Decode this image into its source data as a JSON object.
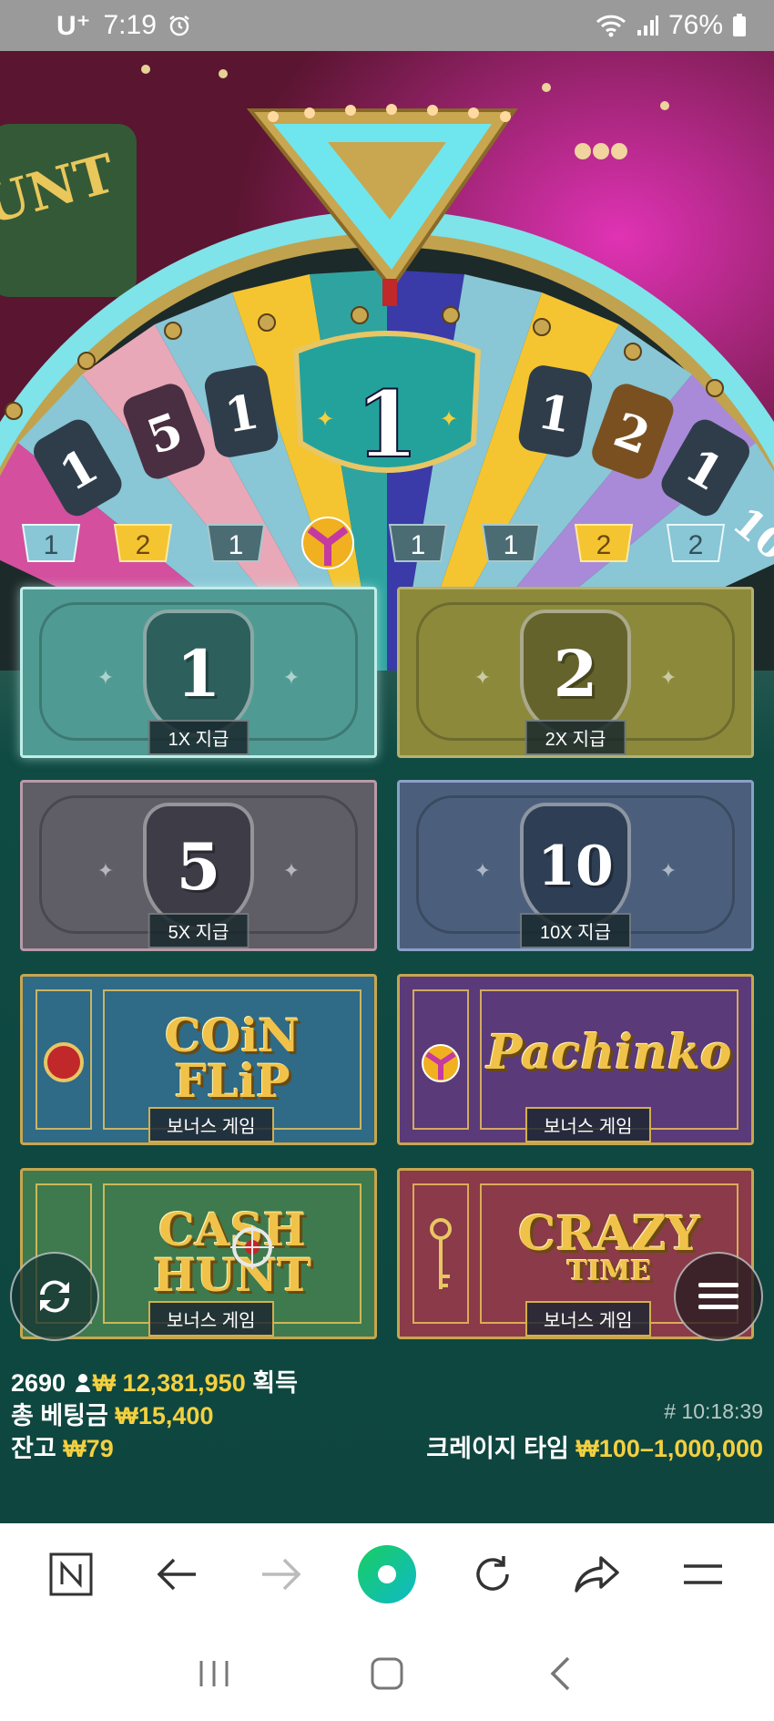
{
  "status_bar": {
    "carrier": "U⁺",
    "time": "7:19",
    "battery": "76%",
    "icons": [
      "alarm-icon",
      "wifi-icon",
      "signal-icon",
      "battery-icon"
    ]
  },
  "wheel": {
    "pointer_value": "1",
    "segment_labels": [
      "1",
      "5",
      "1",
      "1",
      "2",
      "1",
      "10"
    ],
    "tab_labels": [
      "1",
      "2",
      "1",
      "1",
      "1",
      "2",
      "2"
    ]
  },
  "bet_tiles": [
    {
      "number": "1",
      "label": "1X 지급",
      "color": "#4f9b93"
    },
    {
      "number": "2",
      "label": "2X 지급",
      "color": "#8c8a3a"
    },
    {
      "number": "5",
      "label": "5X 지급",
      "color": "#5f5d66"
    },
    {
      "number": "10",
      "label": "10X 지급",
      "color": "#4b5f7c"
    }
  ],
  "bonus_tiles": [
    {
      "name": "COIN FLIP",
      "line1": "COiN",
      "line2": "FLiP",
      "label": "보너스 게임",
      "color": "#2f6a87"
    },
    {
      "name": "Pachinko",
      "line1": "Pachinko",
      "line2": "",
      "label": "보너스 게임",
      "color": "#5a3a78"
    },
    {
      "name": "CASH HUNT",
      "line1": "CASH",
      "line2": "HUNT",
      "label": "보너스 게임",
      "color": "#3e7a4e"
    },
    {
      "name": "CRAZY TIME",
      "line1": "CRAZY",
      "line2": "TIME",
      "label": "보너스 게임",
      "color": "#8a3a48"
    }
  ],
  "info": {
    "players": "2690",
    "win_amount": "₩ 12,381,950",
    "win_suffix": "획득",
    "total_bet_label": "총 베팅금",
    "total_bet": "₩15,400",
    "balance_label": "잔고",
    "balance": "₩79",
    "round_id": "# 10:18:39",
    "limit_label": "크레이지 타임",
    "limit_range": "₩100–1,000,000"
  },
  "browser_bar": {
    "buttons": [
      "naver-home-icon",
      "back-arrow-icon",
      "forward-arrow-icon",
      "green-dot-icon",
      "reload-icon",
      "share-icon",
      "menu-icon"
    ]
  },
  "colors": {
    "accent_yellow": "#f4d03f",
    "game_bg": "#0e463f",
    "naver_green": "#19ce60"
  }
}
